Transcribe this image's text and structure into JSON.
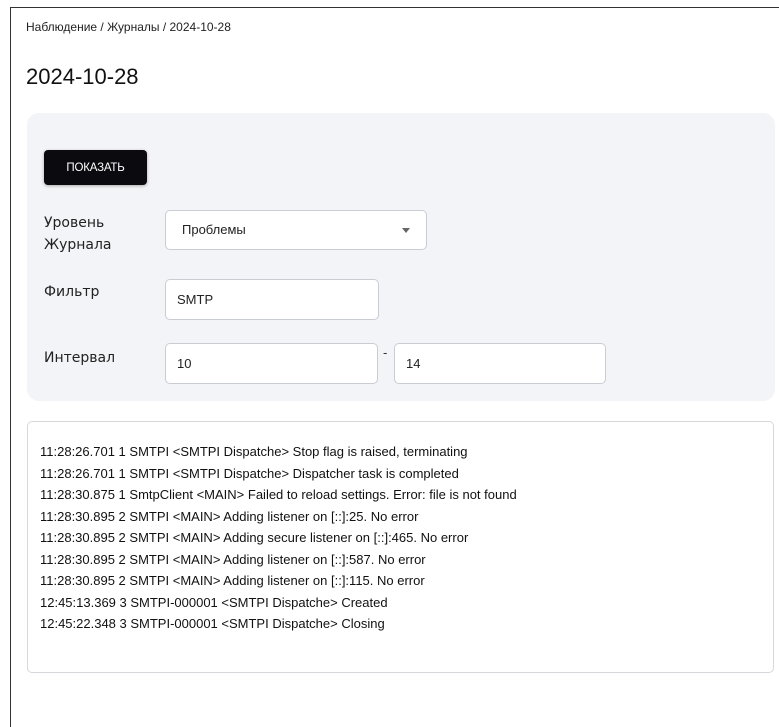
{
  "breadcrumb": "Наблюдение / Журналы / 2024-10-28",
  "title": "2024-10-28",
  "form": {
    "show_button": "ПОКАЗАТЬ",
    "level_label": "Уровень Журнала",
    "level_value": "Проблемы",
    "filter_label": "Фильтр",
    "filter_value": "SMTP",
    "interval_label": "Интервал",
    "interval_from": "10",
    "interval_separator": "-",
    "interval_to": "14"
  },
  "log": {
    "lines": [
      "11:28:26.701 1 SMTPI <SMTPI Dispatche> Stop flag is raised, terminating",
      "11:28:26.701 1 SMTPI <SMTPI Dispatche> Dispatcher task is completed",
      "11:28:30.875 1 SmtpClient <MAIN> Failed to reload settings. Error: file is not found",
      "11:28:30.895 2 SMTPI <MAIN> Adding listener on [::]:25. No error",
      "11:28:30.895 2 SMTPI <MAIN> Adding secure listener on [::]:465. No error",
      "11:28:30.895 2 SMTPI <MAIN> Adding listener on [::]:587. No error",
      "11:28:30.895 2 SMTPI <MAIN> Adding listener on [::]:115. No error",
      "12:45:13.369 3 SMTPI-000001 <SMTPI Dispatche> Created",
      "12:45:22.348 3 SMTPI-000001 <SMTPI Dispatche> Closing"
    ]
  },
  "icons": {
    "select_caret": "caret-down-icon"
  }
}
